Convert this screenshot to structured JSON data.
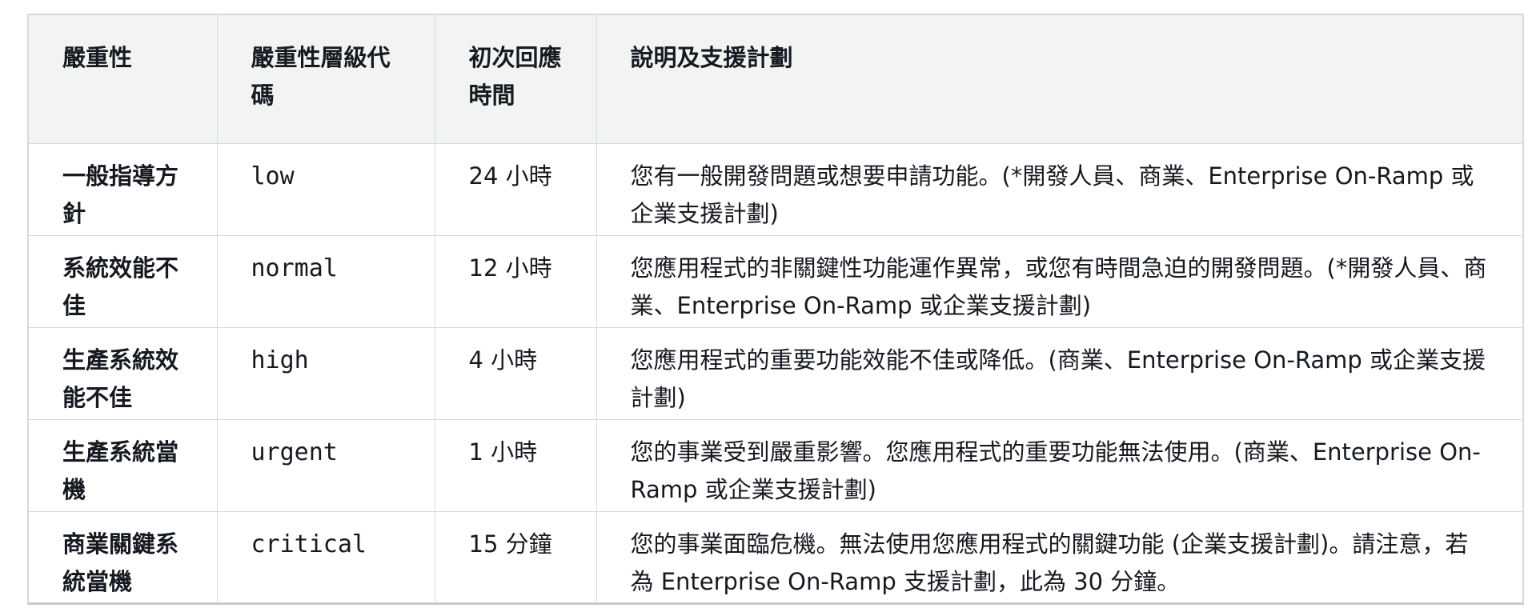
{
  "table": {
    "headers": [
      "嚴重性",
      "嚴重性層級代碼",
      "初次回應時間",
      "說明及支援計劃"
    ],
    "rows": [
      {
        "severity": "一般指導方針",
        "code": "low",
        "response": "24 小時",
        "description": "您有一般開發問題或想要申請功能。(*開發人員、商業、Enterprise On-Ramp 或企業支援計劃)"
      },
      {
        "severity": "系統效能不佳",
        "code": "normal",
        "response": "12 小時",
        "description": "您應用程式的非關鍵性功能運作異常，或您有時間急迫的開發問題。(*開發人員、商業、Enterprise On-Ramp 或企業支援計劃)"
      },
      {
        "severity": "生產系統效能不佳",
        "code": "high",
        "response": "4 小時",
        "description": "您應用程式的重要功能效能不佳或降低。(商業、Enterprise On-Ramp 或企業支援計劃)"
      },
      {
        "severity": "生產系統當機",
        "code": "urgent",
        "response": "1 小時",
        "description": "您的事業受到嚴重影響。您應用程式的重要功能無法使用。(商業、Enterprise On-Ramp 或企業支援計劃)"
      },
      {
        "severity": "商業關鍵系統當機",
        "code": "critical",
        "response": "15 分鐘",
        "description": "您的事業面臨危機。無法使用您應用程式的關鍵功能 (企業支援計劃)。請注意，若為 Enterprise On-Ramp 支援計劃，此為 30 分鐘。"
      }
    ]
  }
}
